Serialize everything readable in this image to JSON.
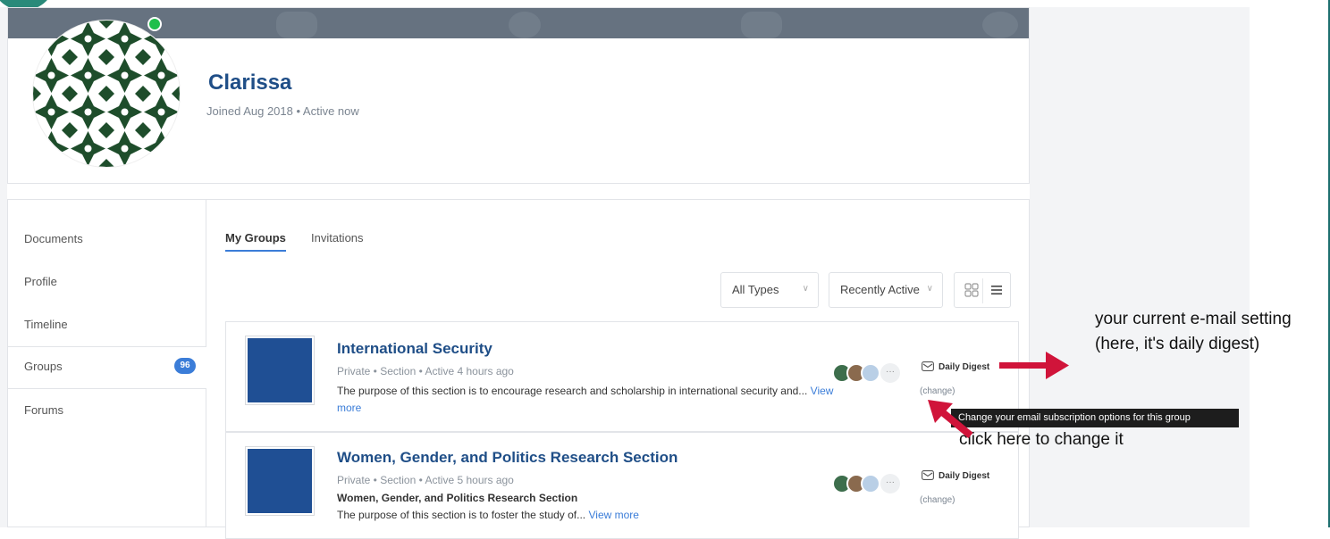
{
  "profile": {
    "name": "Clarissa",
    "meta": "Joined Aug 2018 • Active now"
  },
  "sidebar": {
    "items": [
      {
        "label": "Documents"
      },
      {
        "label": "Profile"
      },
      {
        "label": "Timeline"
      },
      {
        "label": "Groups",
        "badge": "96"
      },
      {
        "label": "Forums"
      }
    ]
  },
  "tabs": [
    {
      "label": "My Groups",
      "active": true
    },
    {
      "label": "Invitations",
      "active": false
    }
  ],
  "filters": {
    "type": "All Types",
    "sort": "Recently Active"
  },
  "groups": [
    {
      "title": "International Security",
      "meta": "Private • Section • Active 4 hours ago",
      "subtitle": "",
      "description": "The purpose of this section is to encourage research and scholarship in international security and...",
      "view_more": "View more",
      "digest": "Daily Digest",
      "change": "(change)",
      "members_more": "···"
    },
    {
      "title": "Women, Gender, and Politics Research Section",
      "meta": "Private • Section • Active 5 hours ago",
      "subtitle": "Women, Gender, and Politics Research Section",
      "description": "The purpose of this section is to foster the study of...",
      "view_more": "View more",
      "digest": "Daily Digest",
      "change": "(change)",
      "members_more": "···"
    }
  ],
  "tooltip": "Change your email subscription options for this group",
  "annotations": {
    "digest_note": "your current e-mail setting (here, it's daily digest)",
    "change_note": "click here to change it"
  },
  "colors": {
    "accent": "#1f4e87",
    "link": "#3b7dd8",
    "arrow": "#d0143a",
    "thumb": "#1f4f94",
    "online": "#1fbf4a",
    "avatar_pattern": "#1e4d2b"
  }
}
